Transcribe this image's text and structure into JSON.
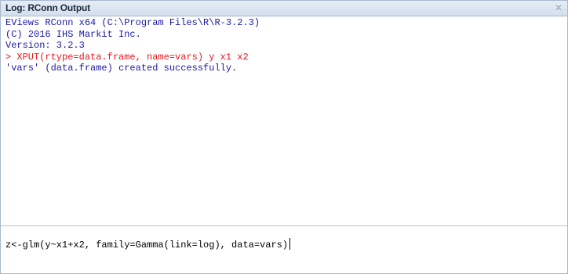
{
  "window": {
    "title": "Log: RConn Output",
    "close_glyph": "✕"
  },
  "output": {
    "lines": [
      {
        "text": "EViews RConn x64 (C:\\Program Files\\R\\R-3.2.3)",
        "kind": "info"
      },
      {
        "text": "(C) 2016 IHS Markit Inc.",
        "kind": "info"
      },
      {
        "text": "Version: 3.2.3",
        "kind": "info"
      },
      {
        "text": "> XPUT(rtype=data.frame, name=vars) y x1 x2",
        "kind": "command-echo"
      },
      {
        "text": "'vars' (data.frame) created successfully.",
        "kind": "info"
      }
    ]
  },
  "command": {
    "value": "z<-glm(y~x1+x2, family=Gamma(link=log), data=vars)"
  },
  "colors": {
    "info_text": "#1a1aa8",
    "command_echo": "#e8161c",
    "title_text": "#1c2a3c"
  }
}
